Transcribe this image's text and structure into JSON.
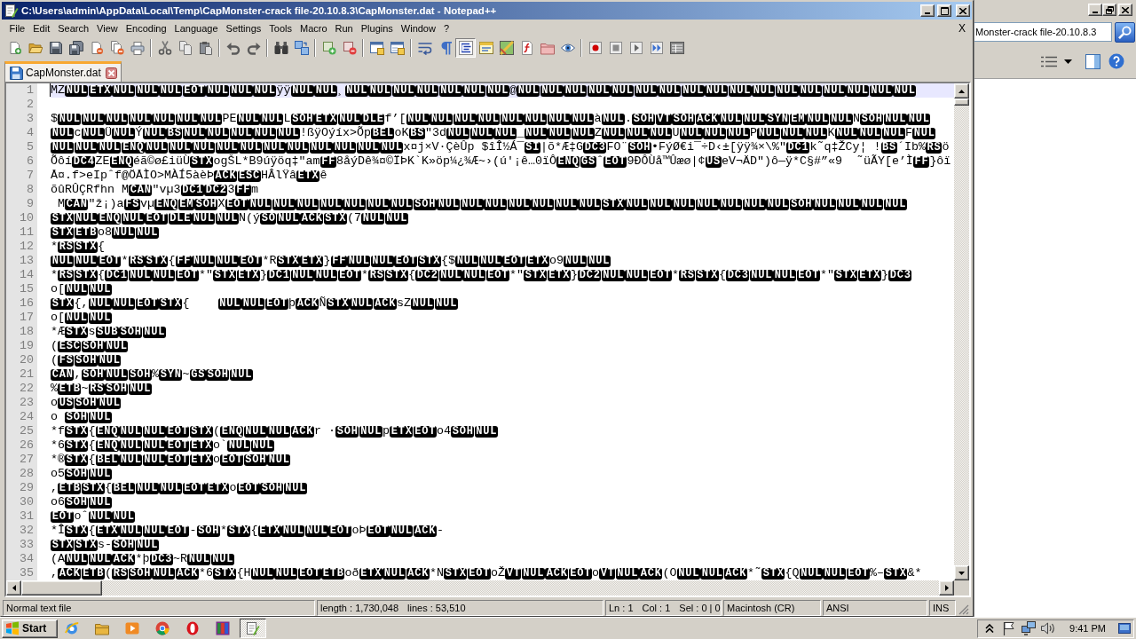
{
  "window": {
    "title": "C:\\Users\\admin\\AppData\\Local\\Temp\\CapMonster-crack file-20.10.8.3\\CapMonster.dat - Notepad++"
  },
  "menu_bar": {
    "items": [
      "File",
      "Edit",
      "Search",
      "View",
      "Encoding",
      "Language",
      "Settings",
      "Tools",
      "Macro",
      "Run",
      "Plugins",
      "Window",
      "?"
    ],
    "close_button": "X"
  },
  "toolbar": {
    "word_wrap": false,
    "show_all_characters": false,
    "indent_guide": true
  },
  "tabs": [
    {
      "label": "CapMonster.dat",
      "selected": true
    }
  ],
  "editor": {
    "lines": [
      {
        "number": "1",
        "current": true,
        "parts": [
          {
            "kind": "text",
            "text": "MZ"
          },
          {
            "kind": "control",
            "codes": [
              "NUL",
              "ETX",
              "NUL",
              "NUL",
              "NUL",
              "EOT",
              "NUL",
              "NUL",
              "NUL"
            ]
          },
          {
            "kind": "text",
            "text": "ÿÿ"
          },
          {
            "kind": "control",
            "codes": [
              "NUL",
              "NUL"
            ]
          },
          {
            "kind": "text",
            "text": "¸"
          },
          {
            "kind": "control",
            "codes": [
              "NUL",
              "NUL",
              "NUL",
              "NUL",
              "NUL",
              "NUL",
              "NUL"
            ]
          },
          {
            "kind": "text",
            "text": "@"
          },
          {
            "kind": "control",
            "codes": [
              "NUL",
              "NUL",
              "NUL",
              "NUL",
              "NUL",
              "NUL",
              "NUL",
              "NUL",
              "NUL",
              "NUL",
              "NUL",
              "NUL",
              "NUL",
              "NUL",
              "NUL",
              "NUL",
              "NUL"
            ]
          }
        ]
      },
      {
        "number": "2",
        "current": false
      },
      {
        "number": "3",
        "current": false,
        "parts": [
          {
            "kind": "text",
            "text": "$"
          },
          {
            "kind": "control",
            "codes": [
              "NUL",
              "NUL",
              "NUL",
              "NUL",
              "NUL",
              "NUL",
              "NUL"
            ]
          },
          {
            "kind": "text",
            "text": "PE"
          },
          {
            "kind": "control",
            "codes": [
              "NUL",
              "NUL"
            ]
          },
          {
            "kind": "text",
            "text": "L"
          },
          {
            "kind": "control",
            "codes": [
              "SOH",
              "ETX",
              "NUL",
              "DLE"
            ]
          },
          {
            "kind": "text",
            "text": "f’["
          },
          {
            "kind": "control",
            "codes": [
              "NUL",
              "NUL",
              "NUL",
              "NUL",
              "NUL",
              "NUL",
              "NUL",
              "NUL"
            ]
          },
          {
            "kind": "text",
            "text": "à"
          },
          {
            "kind": "control",
            "codes": [
              "NUL"
            ]
          },
          {
            "kind": "text",
            "text": "."
          },
          {
            "kind": "control",
            "codes": [
              "SOH",
              "VT",
              "SOH",
              "ACK",
              "NUL",
              "NUL",
              "SYN",
              "EM",
              "NUL",
              "NUL"
            ]
          },
          {
            "kind": "text",
            "text": "N"
          },
          {
            "kind": "control",
            "codes": [
              "SOH",
              "NUL",
              "NUL"
            ]
          }
        ]
      },
      {
        "number": "4",
        "current": false,
        "parts": [
          {
            "kind": "control",
            "codes": [
              "NUL"
            ]
          },
          {
            "kind": "text",
            "text": "c"
          },
          {
            "kind": "control",
            "codes": [
              "NUL"
            ]
          },
          {
            "kind": "text",
            "text": "Ü"
          },
          {
            "kind": "control",
            "codes": [
              "NUL"
            ]
          },
          {
            "kind": "text",
            "text": "Ý"
          },
          {
            "kind": "control",
            "codes": [
              "NUL",
              "BS",
              "NUL",
              "NUL",
              "NUL",
              "NUL",
              "NUL"
            ]
          },
          {
            "kind": "text",
            "text": "!ßÿOýíx>Õp"
          },
          {
            "kind": "control",
            "codes": [
              "BEL"
            ]
          },
          {
            "kind": "text",
            "text": "oK"
          },
          {
            "kind": "control",
            "codes": [
              "BS"
            ]
          },
          {
            "kind": "text",
            "text": "\"3d"
          },
          {
            "kind": "control",
            "codes": [
              "NUL",
              "NUL",
              "NUL"
            ]
          },
          {
            "kind": "text",
            "text": "_"
          },
          {
            "kind": "control",
            "codes": [
              "NUL",
              "NUL",
              "NUL"
            ]
          },
          {
            "kind": "text",
            "text": "Z"
          },
          {
            "kind": "control",
            "codes": [
              "NUL",
              "NUL",
              "NUL"
            ]
          },
          {
            "kind": "text",
            "text": "U"
          },
          {
            "kind": "control",
            "codes": [
              "NUL",
              "NUL",
              "NUL"
            ]
          },
          {
            "kind": "text",
            "text": "P"
          },
          {
            "kind": "control",
            "codes": [
              "NUL",
              "NUL",
              "NUL"
            ]
          },
          {
            "kind": "text",
            "text": "K"
          },
          {
            "kind": "control",
            "codes": [
              "NUL",
              "NUL",
              "NUL"
            ]
          },
          {
            "kind": "text",
            "text": "F"
          },
          {
            "kind": "control",
            "codes": [
              "NUL"
            ]
          }
        ]
      },
      {
        "number": "5",
        "current": false,
        "parts": [
          {
            "kind": "control",
            "codes": [
              "NUL",
              "NUL",
              "NUL",
              "ENQ",
              "NUL",
              "NUL",
              "NUL",
              "NUL",
              "NUL",
              "NUL",
              "NUL",
              "NUL",
              "NUL",
              "NUL",
              "NUL"
            ]
          },
          {
            "kind": "text",
            "text": "x¤j×V·ÇèÛp $îÎ½Á¯"
          },
          {
            "kind": "control",
            "codes": [
              "SI"
            ]
          },
          {
            "kind": "text",
            "text": "|õ*Æ‡G"
          },
          {
            "kind": "control",
            "codes": [
              "DC3"
            ]
          },
          {
            "kind": "text",
            "text": "FO¨"
          },
          {
            "kind": "control",
            "codes": [
              "SOH"
            ]
          },
          {
            "kind": "text",
            "text": "•FýØ€i¯÷D‹±[ÿÿ¾×\\%\""
          },
          {
            "kind": "control",
            "codes": [
              "DC1"
            ]
          },
          {
            "kind": "text",
            "text": "k˜q‡ŽCy¦ !"
          },
          {
            "kind": "control",
            "codes": [
              "BS"
            ]
          },
          {
            "kind": "text",
            "text": "´Ib%"
          },
          {
            "kind": "control",
            "codes": [
              "RS"
            ]
          },
          {
            "kind": "text",
            "text": "ö"
          }
        ]
      },
      {
        "number": "6",
        "current": false,
        "parts": [
          {
            "kind": "text",
            "text": "Õôí"
          },
          {
            "kind": "control",
            "codes": [
              "DC4"
            ]
          },
          {
            "kind": "text",
            "text": "ZE"
          },
          {
            "kind": "control",
            "codes": [
              "ENQ"
            ]
          },
          {
            "kind": "text",
            "text": "éã©ø£iüÙ"
          },
          {
            "kind": "control",
            "codes": [
              "STX"
            ]
          },
          {
            "kind": "text",
            "text": "ogŠL*B9úÿöq‡\"am"
          },
          {
            "kind": "control",
            "codes": [
              "FF"
            ]
          },
          {
            "kind": "text",
            "text": "8åýDê¾¤©ÏÞK`K»öp¼¿¾Æ~›(ú'¡ê…0ïÔ"
          },
          {
            "kind": "control",
            "codes": [
              "ENQ",
              "GS"
            ]
          },
          {
            "kind": "text",
            "text": "ˆ"
          },
          {
            "kind": "control",
            "codes": [
              "EOT"
            ]
          },
          {
            "kind": "text",
            "text": "9ÐÔÙå™Ûæø|¢"
          },
          {
            "kind": "control",
            "codes": [
              "US"
            ]
          },
          {
            "kind": "text",
            "text": "eV¬ÄD\")ô—ÿ*C§#”«9  ˜üÃY[e’Ì"
          },
          {
            "kind": "control",
            "codes": [
              "FF"
            ]
          },
          {
            "kind": "text",
            "text": "}ôï"
          }
        ]
      },
      {
        "number": "7",
        "current": false,
        "parts": [
          {
            "kind": "text",
            "text": "Å¤.f>eIpˆf@ÖÅÌO>MÀÍ5àèÞ"
          },
          {
            "kind": "control",
            "codes": [
              "ACK",
              "ESC"
            ]
          },
          {
            "kind": "text",
            "text": "HÂlŸâ"
          },
          {
            "kind": "control",
            "codes": [
              "ETX"
            ]
          },
          {
            "kind": "text",
            "text": "ê"
          }
        ]
      },
      {
        "number": "8",
        "current": false,
        "parts": [
          {
            "kind": "text",
            "text": "õûRÛÇRfhn M"
          },
          {
            "kind": "control",
            "codes": [
              "CAN"
            ]
          },
          {
            "kind": "text",
            "text": "\"vµ3"
          },
          {
            "kind": "control",
            "codes": [
              "DC1",
              "DC2"
            ]
          },
          {
            "kind": "text",
            "text": "3"
          },
          {
            "kind": "control",
            "codes": [
              "FF"
            ]
          },
          {
            "kind": "text",
            "text": "m"
          }
        ]
      },
      {
        "number": "9",
        "current": false,
        "parts": [
          {
            "kind": "text",
            "text": " M"
          },
          {
            "kind": "control",
            "codes": [
              "CAN"
            ]
          },
          {
            "kind": "text",
            "text": "\"ž¡)a"
          },
          {
            "kind": "control",
            "codes": [
              "FS"
            ]
          },
          {
            "kind": "text",
            "text": "vµ"
          },
          {
            "kind": "control",
            "codes": [
              "ENQ",
              "EM",
              "SOH"
            ]
          },
          {
            "kind": "text",
            "text": "X"
          },
          {
            "kind": "control",
            "codes": [
              "EOT",
              "NUL",
              "NUL",
              "NUL",
              "NUL",
              "NUL",
              "NUL",
              "NUL",
              "SOH",
              "NUL",
              "NUL",
              "NUL",
              "NUL",
              "NUL",
              "NUL",
              "NUL",
              "STX",
              "NUL",
              "NUL",
              "NUL",
              "NUL",
              "NUL",
              "NUL",
              "NUL",
              "SOH",
              "NUL",
              "NUL",
              "NUL",
              "NUL"
            ]
          }
        ]
      },
      {
        "number": "10",
        "current": false,
        "parts": [
          {
            "kind": "control",
            "codes": [
              "STX",
              "NUL",
              "ENQ",
              "NUL",
              "EOT",
              "DLE",
              "NUL",
              "NUL"
            ]
          },
          {
            "kind": "text",
            "text": "N(ý"
          },
          {
            "kind": "control",
            "codes": [
              "SO",
              "NUL",
              "ACK",
              "STX"
            ]
          },
          {
            "kind": "text",
            "text": "(7"
          },
          {
            "kind": "control",
            "codes": [
              "NUL",
              "NUL"
            ]
          }
        ]
      },
      {
        "number": "11",
        "current": false,
        "parts": [
          {
            "kind": "control",
            "codes": [
              "STX",
              "ETB"
            ]
          },
          {
            "kind": "text",
            "text": "o8"
          },
          {
            "kind": "control",
            "codes": [
              "NUL",
              "NUL"
            ]
          }
        ]
      },
      {
        "number": "12",
        "current": false,
        "parts": [
          {
            "kind": "text",
            "text": "*"
          },
          {
            "kind": "control",
            "codes": [
              "RS",
              "STX"
            ]
          },
          {
            "kind": "text",
            "text": "{"
          }
        ]
      },
      {
        "number": "13",
        "current": false,
        "parts": [
          {
            "kind": "control",
            "codes": [
              "NUL",
              "NUL",
              "EOT"
            ]
          },
          {
            "kind": "text",
            "text": "*"
          },
          {
            "kind": "control",
            "codes": [
              "RS",
              "STX"
            ]
          },
          {
            "kind": "text",
            "text": "{"
          },
          {
            "kind": "control",
            "codes": [
              "FF",
              "NUL",
              "NUL",
              "EOT"
            ]
          },
          {
            "kind": "text",
            "text": "*R"
          },
          {
            "kind": "control",
            "codes": [
              "STX",
              "ETX"
            ]
          },
          {
            "kind": "text",
            "text": "}"
          },
          {
            "kind": "control",
            "codes": [
              "FF",
              "NUL",
              "NUL",
              "EOT",
              "STX"
            ]
          },
          {
            "kind": "text",
            "text": "{$"
          },
          {
            "kind": "control",
            "codes": [
              "NUL",
              "NUL",
              "EOT",
              "ETX"
            ]
          },
          {
            "kind": "text",
            "text": "o9"
          },
          {
            "kind": "control",
            "codes": [
              "NUL",
              "NUL"
            ]
          }
        ]
      },
      {
        "number": "14",
        "current": false,
        "parts": [
          {
            "kind": "text",
            "text": "*"
          },
          {
            "kind": "control",
            "codes": [
              "RS",
              "STX"
            ]
          },
          {
            "kind": "text",
            "text": "{"
          },
          {
            "kind": "control",
            "codes": [
              "DC1",
              "NUL",
              "NUL",
              "EOT"
            ]
          },
          {
            "kind": "text",
            "text": "*\""
          },
          {
            "kind": "control",
            "codes": [
              "STX",
              "ETX"
            ]
          },
          {
            "kind": "text",
            "text": "}"
          },
          {
            "kind": "control",
            "codes": [
              "DC1",
              "NUL",
              "NUL",
              "EOT"
            ]
          },
          {
            "kind": "text",
            "text": "*"
          },
          {
            "kind": "control",
            "codes": [
              "RS",
              "STX"
            ]
          },
          {
            "kind": "text",
            "text": "{"
          },
          {
            "kind": "control",
            "codes": [
              "DC2",
              "NUL",
              "NUL",
              "EOT"
            ]
          },
          {
            "kind": "text",
            "text": "*\""
          },
          {
            "kind": "control",
            "codes": [
              "STX",
              "ETX"
            ]
          },
          {
            "kind": "text",
            "text": "}"
          },
          {
            "kind": "control",
            "codes": [
              "DC2",
              "NUL",
              "NUL",
              "EOT"
            ]
          },
          {
            "kind": "text",
            "text": "*"
          },
          {
            "kind": "control",
            "codes": [
              "RS",
              "STX"
            ]
          },
          {
            "kind": "text",
            "text": "{"
          },
          {
            "kind": "control",
            "codes": [
              "DC3",
              "NUL",
              "NUL",
              "EOT"
            ]
          },
          {
            "kind": "text",
            "text": "*\""
          },
          {
            "kind": "control",
            "codes": [
              "STX",
              "ETX"
            ]
          },
          {
            "kind": "text",
            "text": "}"
          },
          {
            "kind": "control",
            "codes": [
              "DC3"
            ]
          }
        ]
      },
      {
        "number": "15",
        "current": false,
        "parts": [
          {
            "kind": "text",
            "text": "o["
          },
          {
            "kind": "control",
            "codes": [
              "NUL",
              "NUL"
            ]
          }
        ]
      },
      {
        "number": "16",
        "current": false,
        "parts": [
          {
            "kind": "control",
            "codes": [
              "STX"
            ]
          },
          {
            "kind": "text",
            "text": "{,"
          },
          {
            "kind": "control",
            "codes": [
              "NUL",
              "NUL",
              "EOT",
              "STX"
            ]
          },
          {
            "kind": "text",
            "text": "{    "
          },
          {
            "kind": "control",
            "codes": [
              "NUL",
              "NUL",
              "EOT"
            ]
          },
          {
            "kind": "text",
            "text": "þ"
          },
          {
            "kind": "control",
            "codes": [
              "ACK"
            ]
          },
          {
            "kind": "text",
            "text": "Ñ"
          },
          {
            "kind": "control",
            "codes": [
              "STX",
              "NUL",
              "ACK"
            ]
          },
          {
            "kind": "text",
            "text": "sZ"
          },
          {
            "kind": "control",
            "codes": [
              "NUL",
              "NUL"
            ]
          }
        ]
      },
      {
        "number": "17",
        "current": false,
        "parts": [
          {
            "kind": "text",
            "text": "o["
          },
          {
            "kind": "control",
            "codes": [
              "NUL",
              "NUL"
            ]
          }
        ]
      },
      {
        "number": "18",
        "current": false,
        "parts": [
          {
            "kind": "text",
            "text": "*Æ"
          },
          {
            "kind": "control",
            "codes": [
              "STX"
            ]
          },
          {
            "kind": "text",
            "text": "s"
          },
          {
            "kind": "control",
            "codes": [
              "SUB",
              "SOH",
              "NUL"
            ]
          }
        ]
      },
      {
        "number": "19",
        "current": false,
        "parts": [
          {
            "kind": "text",
            "text": "("
          },
          {
            "kind": "control",
            "codes": [
              "ESC",
              "SOH",
              "NUL"
            ]
          }
        ]
      },
      {
        "number": "20",
        "current": false,
        "parts": [
          {
            "kind": "text",
            "text": "("
          },
          {
            "kind": "control",
            "codes": [
              "FS",
              "SOH",
              "NUL"
            ]
          }
        ]
      },
      {
        "number": "21",
        "current": false,
        "parts": [
          {
            "kind": "control",
            "codes": [
              "CAN"
            ]
          },
          {
            "kind": "text",
            "text": ","
          },
          {
            "kind": "control",
            "codes": [
              "SOH",
              "NUL",
              "SOH"
            ]
          },
          {
            "kind": "text",
            "text": "%"
          },
          {
            "kind": "control",
            "codes": [
              "SYN"
            ]
          },
          {
            "kind": "text",
            "text": "~"
          },
          {
            "kind": "control",
            "codes": [
              "GS",
              "SOH",
              "NUL"
            ]
          }
        ]
      },
      {
        "number": "22",
        "current": false,
        "parts": [
          {
            "kind": "text",
            "text": "%"
          },
          {
            "kind": "control",
            "codes": [
              "ETB"
            ]
          },
          {
            "kind": "text",
            "text": "~"
          },
          {
            "kind": "control",
            "codes": [
              "RS",
              "SOH",
              "NUL"
            ]
          }
        ]
      },
      {
        "number": "23",
        "current": false,
        "parts": [
          {
            "kind": "text",
            "text": "o"
          },
          {
            "kind": "control",
            "codes": [
              "US",
              "SOH",
              "NUL"
            ]
          }
        ]
      },
      {
        "number": "24",
        "current": false,
        "parts": [
          {
            "kind": "text",
            "text": "o "
          },
          {
            "kind": "control",
            "codes": [
              "SOH",
              "NUL"
            ]
          }
        ]
      },
      {
        "number": "25",
        "current": false,
        "parts": [
          {
            "kind": "text",
            "text": "*f"
          },
          {
            "kind": "control",
            "codes": [
              "STX"
            ]
          },
          {
            "kind": "text",
            "text": "{"
          },
          {
            "kind": "control",
            "codes": [
              "ENQ",
              "NUL",
              "NUL",
              "EOT",
              "STX"
            ]
          },
          {
            "kind": "text",
            "text": "("
          },
          {
            "kind": "control",
            "codes": [
              "ENQ",
              "NUL",
              "NUL",
              "ACK"
            ]
          },
          {
            "kind": "text",
            "text": "r ·"
          },
          {
            "kind": "control",
            "codes": [
              "SOH",
              "NUL"
            ]
          },
          {
            "kind": "text",
            "text": "p"
          },
          {
            "kind": "control",
            "codes": [
              "ETX",
              "EOT"
            ]
          },
          {
            "kind": "text",
            "text": "o4"
          },
          {
            "kind": "control",
            "codes": [
              "SOH",
              "NUL"
            ]
          }
        ]
      },
      {
        "number": "26",
        "current": false,
        "parts": [
          {
            "kind": "text",
            "text": "*6"
          },
          {
            "kind": "control",
            "codes": [
              "STX"
            ]
          },
          {
            "kind": "text",
            "text": "{"
          },
          {
            "kind": "control",
            "codes": [
              "ENQ",
              "NUL",
              "NUL",
              "EOT",
              "ETX"
            ]
          },
          {
            "kind": "text",
            "text": "o`"
          },
          {
            "kind": "control",
            "codes": [
              "NUL",
              "NUL"
            ]
          }
        ]
      },
      {
        "number": "27",
        "current": false,
        "parts": [
          {
            "kind": "text",
            "text": "*®"
          },
          {
            "kind": "control",
            "codes": [
              "STX"
            ]
          },
          {
            "kind": "text",
            "text": "{"
          },
          {
            "kind": "control",
            "codes": [
              "BEL",
              "NUL",
              "NUL",
              "EOT",
              "ETX"
            ]
          },
          {
            "kind": "text",
            "text": "o"
          },
          {
            "kind": "control",
            "codes": [
              "EOT",
              "SOH",
              "NUL"
            ]
          }
        ]
      },
      {
        "number": "28",
        "current": false,
        "parts": [
          {
            "kind": "text",
            "text": "o5"
          },
          {
            "kind": "control",
            "codes": [
              "SOH",
              "NUL"
            ]
          }
        ]
      },
      {
        "number": "29",
        "current": false,
        "parts": [
          {
            "kind": "text",
            "text": ","
          },
          {
            "kind": "control",
            "codes": [
              "ETB",
              "STX"
            ]
          },
          {
            "kind": "text",
            "text": "{"
          },
          {
            "kind": "control",
            "codes": [
              "BEL",
              "NUL",
              "NUL",
              "EOT",
              "ETX"
            ]
          },
          {
            "kind": "text",
            "text": "o"
          },
          {
            "kind": "control",
            "codes": [
              "EOT",
              "SOH",
              "NUL"
            ]
          }
        ]
      },
      {
        "number": "30",
        "current": false,
        "parts": [
          {
            "kind": "text",
            "text": "o6"
          },
          {
            "kind": "control",
            "codes": [
              "SOH",
              "NUL"
            ]
          }
        ]
      },
      {
        "number": "31",
        "current": false,
        "parts": [
          {
            "kind": "control",
            "codes": [
              "EOT"
            ]
          },
          {
            "kind": "text",
            "text": "oˆ"
          },
          {
            "kind": "control",
            "codes": [
              "NUL",
              "NUL"
            ]
          }
        ]
      },
      {
        "number": "32",
        "current": false,
        "parts": [
          {
            "kind": "text",
            "text": "*Î"
          },
          {
            "kind": "control",
            "codes": [
              "STX"
            ]
          },
          {
            "kind": "text",
            "text": "{"
          },
          {
            "kind": "control",
            "codes": [
              "ETX",
              "NUL",
              "NUL",
              "EOT"
            ]
          },
          {
            "kind": "text",
            "text": "-"
          },
          {
            "kind": "control",
            "codes": [
              "SOH"
            ]
          },
          {
            "kind": "text",
            "text": "*"
          },
          {
            "kind": "control",
            "codes": [
              "STX"
            ]
          },
          {
            "kind": "text",
            "text": "{"
          },
          {
            "kind": "control",
            "codes": [
              "ETX",
              "NUL",
              "NUL",
              "EOT"
            ]
          },
          {
            "kind": "text",
            "text": "oÞ"
          },
          {
            "kind": "control",
            "codes": [
              "EOT",
              "NUL",
              "ACK"
            ]
          },
          {
            "kind": "text",
            "text": "-"
          }
        ]
      },
      {
        "number": "33",
        "current": false,
        "parts": [
          {
            "kind": "control",
            "codes": [
              "STX",
              "STX"
            ]
          },
          {
            "kind": "text",
            "text": "s-"
          },
          {
            "kind": "control",
            "codes": [
              "SOH",
              "NUL"
            ]
          }
        ]
      },
      {
        "number": "34",
        "current": false,
        "parts": [
          {
            "kind": "text",
            "text": "(A"
          },
          {
            "kind": "control",
            "codes": [
              "NUL",
              "NUL",
              "ACK"
            ]
          },
          {
            "kind": "text",
            "text": "*þ"
          },
          {
            "kind": "control",
            "codes": [
              "DC3"
            ]
          },
          {
            "kind": "text",
            "text": "~R"
          },
          {
            "kind": "control",
            "codes": [
              "NUL",
              "NUL"
            ]
          }
        ]
      },
      {
        "number": "35",
        "current": false,
        "parts": [
          {
            "kind": "text",
            "text": ","
          },
          {
            "kind": "control",
            "codes": [
              "ACK",
              "ETB"
            ]
          },
          {
            "kind": "text",
            "text": "("
          },
          {
            "kind": "control",
            "codes": [
              "RS",
              "SOH",
              "NUL",
              "ACK"
            ]
          },
          {
            "kind": "text",
            "text": "*6"
          },
          {
            "kind": "control",
            "codes": [
              "STX"
            ]
          },
          {
            "kind": "text",
            "text": "{H"
          },
          {
            "kind": "control",
            "codes": [
              "NUL",
              "NUL",
              "EOT",
              "ETB"
            ]
          },
          {
            "kind": "text",
            "text": "oð"
          },
          {
            "kind": "control",
            "codes": [
              "ETX",
              "NUL",
              "ACK"
            ]
          },
          {
            "kind": "text",
            "text": "*N"
          },
          {
            "kind": "control",
            "codes": [
              "STX",
              "EOT"
            ]
          },
          {
            "kind": "text",
            "text": "oŽ"
          },
          {
            "kind": "control",
            "codes": [
              "VT",
              "NUL",
              "ACK",
              "EOT"
            ]
          },
          {
            "kind": "text",
            "text": "o"
          },
          {
            "kind": "control",
            "codes": [
              "VT",
              "NUL",
              "ACK"
            ]
          },
          {
            "kind": "text",
            "text": "(O"
          },
          {
            "kind": "control",
            "codes": [
              "NUL",
              "NUL",
              "ACK"
            ]
          },
          {
            "kind": "text",
            "text": "*˜"
          },
          {
            "kind": "control",
            "codes": [
              "STX"
            ]
          },
          {
            "kind": "text",
            "text": "{Q"
          },
          {
            "kind": "control",
            "codes": [
              "NUL",
              "NUL",
              "EOT"
            ]
          },
          {
            "kind": "text",
            "text": "%–"
          },
          {
            "kind": "control",
            "codes": [
              "STX"
            ]
          },
          {
            "kind": "text",
            "text": "&*"
          }
        ]
      }
    ]
  },
  "status_bar": [
    {
      "texts": [
        "Normal text file"
      ]
    },
    {
      "texts": [
        "length : 1,730,048",
        "lines : 53,510"
      ]
    },
    {
      "texts": [
        "Ln : 1",
        "Col : 1",
        "Sel : 0 | 0"
      ]
    },
    {
      "texts": [
        "Macintosh (CR)"
      ]
    },
    {
      "texts": [
        "ANSI"
      ]
    },
    {
      "texts": [
        "INS"
      ]
    }
  ],
  "explorer_window": {
    "address": "Monster-crack file-20.10.8.3"
  },
  "taskbar": {
    "start": "Start",
    "apps": [
      {
        "active": false
      },
      {
        "active": false
      },
      {
        "active": false
      },
      {
        "active": false
      },
      {
        "active": false
      },
      {
        "active": false
      },
      {
        "active": true
      }
    ],
    "clock": "9:41 PM"
  }
}
